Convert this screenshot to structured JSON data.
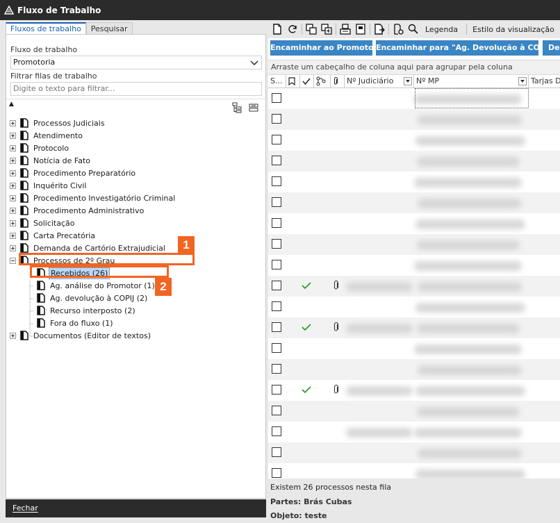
{
  "window": {
    "title": "Fluxo de Trabalho"
  },
  "left": {
    "tabs": [
      {
        "label": "Fluxos de trabalho",
        "active": true
      },
      {
        "label": "Pesquisar",
        "active": false
      }
    ],
    "workflow_label": "Fluxo de trabalho",
    "workflow_value": "Promotoria",
    "filter_label": "Filtrar filas de trabalho",
    "filter_placeholder": "Digite o texto para filtrar...",
    "tree": [
      {
        "label": "Processos Judiciais",
        "expander": "plus"
      },
      {
        "label": "Atendimento",
        "expander": "plus"
      },
      {
        "label": "Protocolo",
        "expander": "plus"
      },
      {
        "label": "Notícia de Fato",
        "expander": "plus"
      },
      {
        "label": "Procedimento Preparatório",
        "expander": "plus"
      },
      {
        "label": "Inquérito Civil",
        "expander": "plus"
      },
      {
        "label": "Procedimento Investigatório Criminal",
        "expander": "plus"
      },
      {
        "label": "Procedimento Administrativo",
        "expander": "plus"
      },
      {
        "label": "Solicitação",
        "expander": "plus"
      },
      {
        "label": "Carta Precatória",
        "expander": "plus"
      },
      {
        "label": "Demanda de Cartório Extrajudicial",
        "expander": "plus"
      },
      {
        "label": "Processos de 2º Grau",
        "expander": "minus"
      }
    ],
    "children": [
      {
        "label": "Recebidos (26)",
        "selected": true
      },
      {
        "label": "Ag. análise do Promotor (1)",
        "selected": false
      },
      {
        "label": "Ag. devolução à COPIJ (2)",
        "selected": false
      },
      {
        "label": "Recurso interposto (2)",
        "selected": false
      },
      {
        "label": "Fora do fluxo (1)",
        "selected": false
      }
    ],
    "last_node": "Documentos (Editor de textos)",
    "close_label": "Fechar"
  },
  "callouts": {
    "one": "1",
    "two": "2",
    "color": "#f26522"
  },
  "right": {
    "toolbar": {
      "legend_label": "Legenda",
      "view_style_label": "Estilo da visualização"
    },
    "actions": [
      "Encaminhar ao Promotor",
      "Encaminhar para \"Ag. Devolução à COPIJ\"",
      "Dev"
    ],
    "groupbar_text": "Arraste um cabeçalho de coluna aqui para agrupar pela coluna",
    "columns": [
      "S...",
      "Nº Judiciário",
      "Nº MP",
      "Tarjas D"
    ],
    "rows": [
      {
        "checked": false,
        "attach": false
      },
      {
        "checked": false,
        "attach": false
      },
      {
        "checked": false,
        "attach": false
      },
      {
        "checked": false,
        "attach": false
      },
      {
        "checked": false,
        "attach": false
      },
      {
        "checked": false,
        "attach": false
      },
      {
        "checked": false,
        "attach": false
      },
      {
        "checked": false,
        "attach": false
      },
      {
        "checked": false,
        "attach": false
      },
      {
        "checked": true,
        "attach": true
      },
      {
        "checked": false,
        "attach": false
      },
      {
        "checked": true,
        "attach": true
      },
      {
        "checked": false,
        "attach": false
      },
      {
        "checked": false,
        "attach": false
      },
      {
        "checked": true,
        "attach": true
      },
      {
        "checked": false,
        "attach": false
      },
      {
        "checked": false,
        "attach": false
      },
      {
        "checked": false,
        "attach": false
      },
      {
        "checked": false,
        "attach": false
      }
    ],
    "footer": {
      "count_text": "Existem 26 processos nesta fila",
      "parties_label": "Partes:",
      "parties_value": "Brás Cubas",
      "object_label": "Objeto:",
      "object_value": "teste"
    },
    "accent_color": "#3a85c4"
  }
}
